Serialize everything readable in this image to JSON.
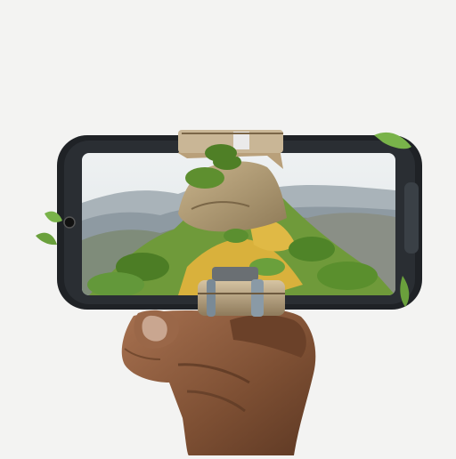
{
  "scene": {
    "background_color": "#f3f3f2",
    "phone_body_color": "#1f2226",
    "sky_color": "#e9eef0",
    "mountain_far_color": "#8e9aa2",
    "hill_green_color": "#6f9a3a",
    "hill_yellow_color": "#d9b13c",
    "rock_color": "#b49a72",
    "hand_skin_color": "#8a5a3a",
    "clamp_color": "#b8a382",
    "moss_color": "#79b34a"
  },
  "icons": {
    "camera": "camera-lens-icon",
    "side_button": "phone-side-button-icon"
  }
}
